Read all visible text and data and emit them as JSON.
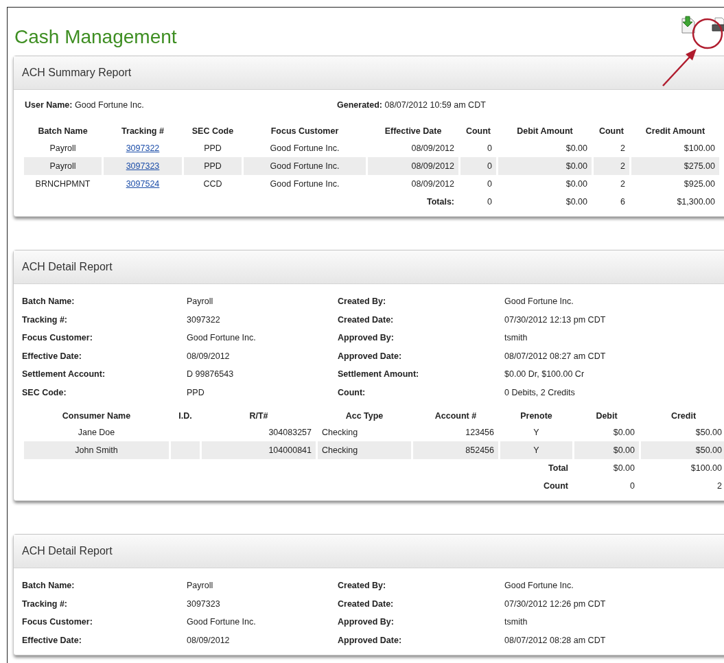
{
  "page": {
    "title": "Cash Management"
  },
  "summary_report": {
    "title": "ACH Summary Report",
    "user_name_label": "User Name:",
    "user_name": "Good Fortune Inc.",
    "generated_label": "Generated:",
    "generated": "08/07/2012 10:59 am CDT",
    "columns": [
      "Batch Name",
      "Tracking #",
      "SEC Code",
      "Focus Customer",
      "Effective Date",
      "Count",
      "Debit Amount",
      "Count",
      "Credit Amount"
    ],
    "rows": [
      {
        "batch_name": "Payroll",
        "tracking": "3097322",
        "sec_code": "PPD",
        "focus_customer": "Good Fortune Inc.",
        "effective_date": "08/09/2012",
        "debit_count": "0",
        "debit_amount": "$0.00",
        "credit_count": "2",
        "credit_amount": "$100.00"
      },
      {
        "batch_name": "Payroll",
        "tracking": "3097323",
        "sec_code": "PPD",
        "focus_customer": "Good Fortune Inc.",
        "effective_date": "08/09/2012",
        "debit_count": "0",
        "debit_amount": "$0.00",
        "credit_count": "2",
        "credit_amount": "$275.00"
      },
      {
        "batch_name": "BRNCHPMNT",
        "tracking": "3097524",
        "sec_code": "CCD",
        "focus_customer": "Good Fortune Inc.",
        "effective_date": "08/09/2012",
        "debit_count": "0",
        "debit_amount": "$0.00",
        "credit_count": "2",
        "credit_amount": "$925.00"
      }
    ],
    "totals": {
      "label": "Totals:",
      "debit_count": "0",
      "debit_amount": "$0.00",
      "credit_count": "6",
      "credit_amount": "$1,300.00"
    }
  },
  "detail_reports": [
    {
      "title": "ACH Detail Report",
      "fields": [
        {
          "left": {
            "label": "Batch Name:",
            "value": "Payroll"
          },
          "right": {
            "label": "Created By:",
            "value": "Good Fortune Inc."
          }
        },
        {
          "left": {
            "label": "Tracking #:",
            "value": "3097322"
          },
          "right": {
            "label": "Created Date:",
            "value": "07/30/2012 12:13 pm CDT"
          }
        },
        {
          "left": {
            "label": "Focus Customer:",
            "value": "Good Fortune Inc."
          },
          "right": {
            "label": "Approved By:",
            "value": "tsmith"
          }
        },
        {
          "left": {
            "label": "Effective Date:",
            "value": "08/09/2012"
          },
          "right": {
            "label": "Approved Date:",
            "value": "08/07/2012 08:27 am CDT"
          }
        },
        {
          "left": {
            "label": "Settlement Account:",
            "value": "D 99876543"
          },
          "right": {
            "label": "Settlement Amount:",
            "value": "$0.00 Dr, $100.00 Cr"
          }
        },
        {
          "left": {
            "label": "SEC Code:",
            "value": "PPD"
          },
          "right": {
            "label": "Count:",
            "value": "0 Debits, 2 Credits"
          }
        }
      ],
      "columns": [
        "Consumer Name",
        "I.D.",
        "R/T#",
        "Acc Type",
        "Account #",
        "Prenote",
        "Debit",
        "Credit"
      ],
      "rows": [
        {
          "consumer_name": "Jane Doe",
          "rt": "304083257",
          "acc_type": "Checking",
          "account": "123456",
          "prenote": "Y",
          "debit": "$0.00",
          "credit": "$50.00"
        },
        {
          "consumer_name": "John Smith",
          "rt": "104000841",
          "acc_type": "Checking",
          "account": "852456",
          "prenote": "Y",
          "debit": "$0.00",
          "credit": "$50.00"
        }
      ],
      "totals": [
        {
          "label": "Total",
          "debit": "$0.00",
          "credit": "$100.00"
        },
        {
          "label": "Count",
          "debit": "0",
          "credit": "2"
        }
      ]
    },
    {
      "title": "ACH Detail Report",
      "fields": [
        {
          "left": {
            "label": "Batch Name:",
            "value": "Payroll"
          },
          "right": {
            "label": "Created By:",
            "value": "Good Fortune Inc."
          }
        },
        {
          "left": {
            "label": "Tracking #:",
            "value": "3097323"
          },
          "right": {
            "label": "Created Date:",
            "value": "07/30/2012 12:26 pm CDT"
          }
        },
        {
          "left": {
            "label": "Focus Customer:",
            "value": "Good Fortune Inc."
          },
          "right": {
            "label": "Approved By:",
            "value": "tsmith"
          }
        },
        {
          "left": {
            "label": "Effective Date:",
            "value": "08/09/2012"
          },
          "right": {
            "label": "Approved Date:",
            "value": "08/07/2012 08:28 am CDT"
          }
        }
      ]
    }
  ]
}
